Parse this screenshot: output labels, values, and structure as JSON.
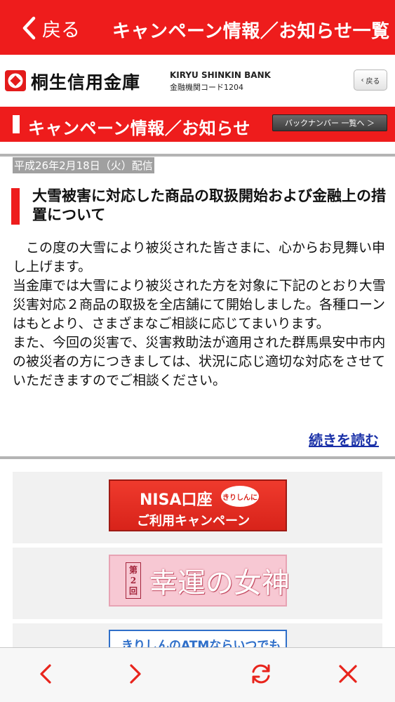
{
  "nav": {
    "back_label": "戻る",
    "title": "キャンペーン情報／お知らせ一覧"
  },
  "bank": {
    "name": "桐生信用金庫",
    "name_en": "KIRYU SHINKIN BANK",
    "code": "金融機関コード1204",
    "back_button": "戻る"
  },
  "section": {
    "title": "キャンペーン情報／お知らせ",
    "backnumber_button": "バックナンバー 一覧へ ＞"
  },
  "article": {
    "date": "平成26年2月18日（火）配信",
    "title": "大雪被害に対応した商品の取扱開始および金融上の措置について",
    "paragraphs": [
      "この度の大雪により被災された皆さまに、心からお見舞い申し上げます。",
      "当金庫では大雪により被災された方を対象に下記のとおり大雪災害対応２商品の取扱を全店舗にて開始しました。各種ローンはもとより、さまざまなご相談に応じてまいります。",
      "また、今回の災害で、災害救助法が適用された群馬県安中市内の被災者の方につきましては、状況に応じ適切な対応をさせていただきますのでご相談ください。"
    ],
    "read_more": "続きを読む"
  },
  "banners": {
    "nisa_main": "NISA口座",
    "nisa_badge": "きりしんに",
    "nisa_sub": "ご利用キャンペーン",
    "goddess_tag_1": "第",
    "goddess_tag_2": "2",
    "goddess_tag_3": "回",
    "goddess_title": "幸運の女神",
    "atm_text": "きりしんのATMならいつでも"
  },
  "toolbar": {
    "back_icon": "chevron-left-icon",
    "forward_icon": "chevron-right-icon",
    "reload_icon": "reload-icon",
    "close_icon": "close-icon"
  },
  "colors": {
    "brand_red": "#ee1c1c",
    "link_blue": "#1a31a8"
  }
}
